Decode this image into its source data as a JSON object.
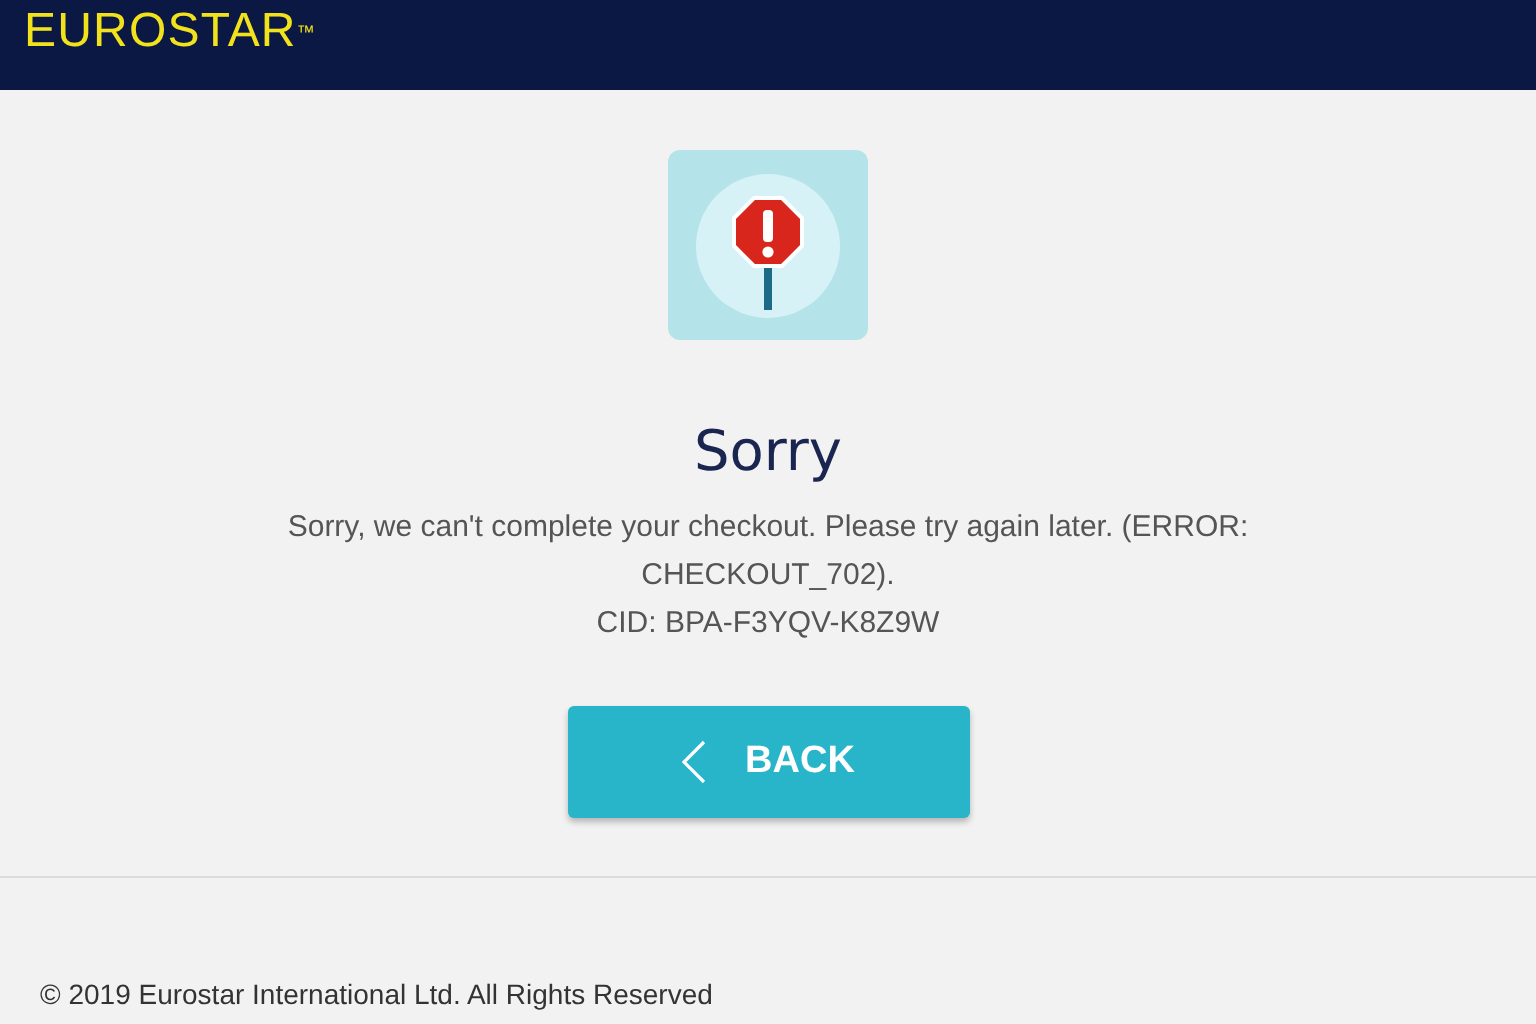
{
  "header": {
    "logo": "EUROSTAR$^{™}$"
  },
  "error": {
    "title": "Sorry",
    "message": "Sorry, we can't complete your checkout. Please try again later. (ERROR: CHECKOUT_702).",
    "cid": "CID: BPA-F3YQV-K8Z9W"
  },
  "back_button": {
    "label": "BACK"
  },
  "footer": {
    "copyright": "© 2019 Eurostar International Ltd. All Rights Reserved"
  }
}
